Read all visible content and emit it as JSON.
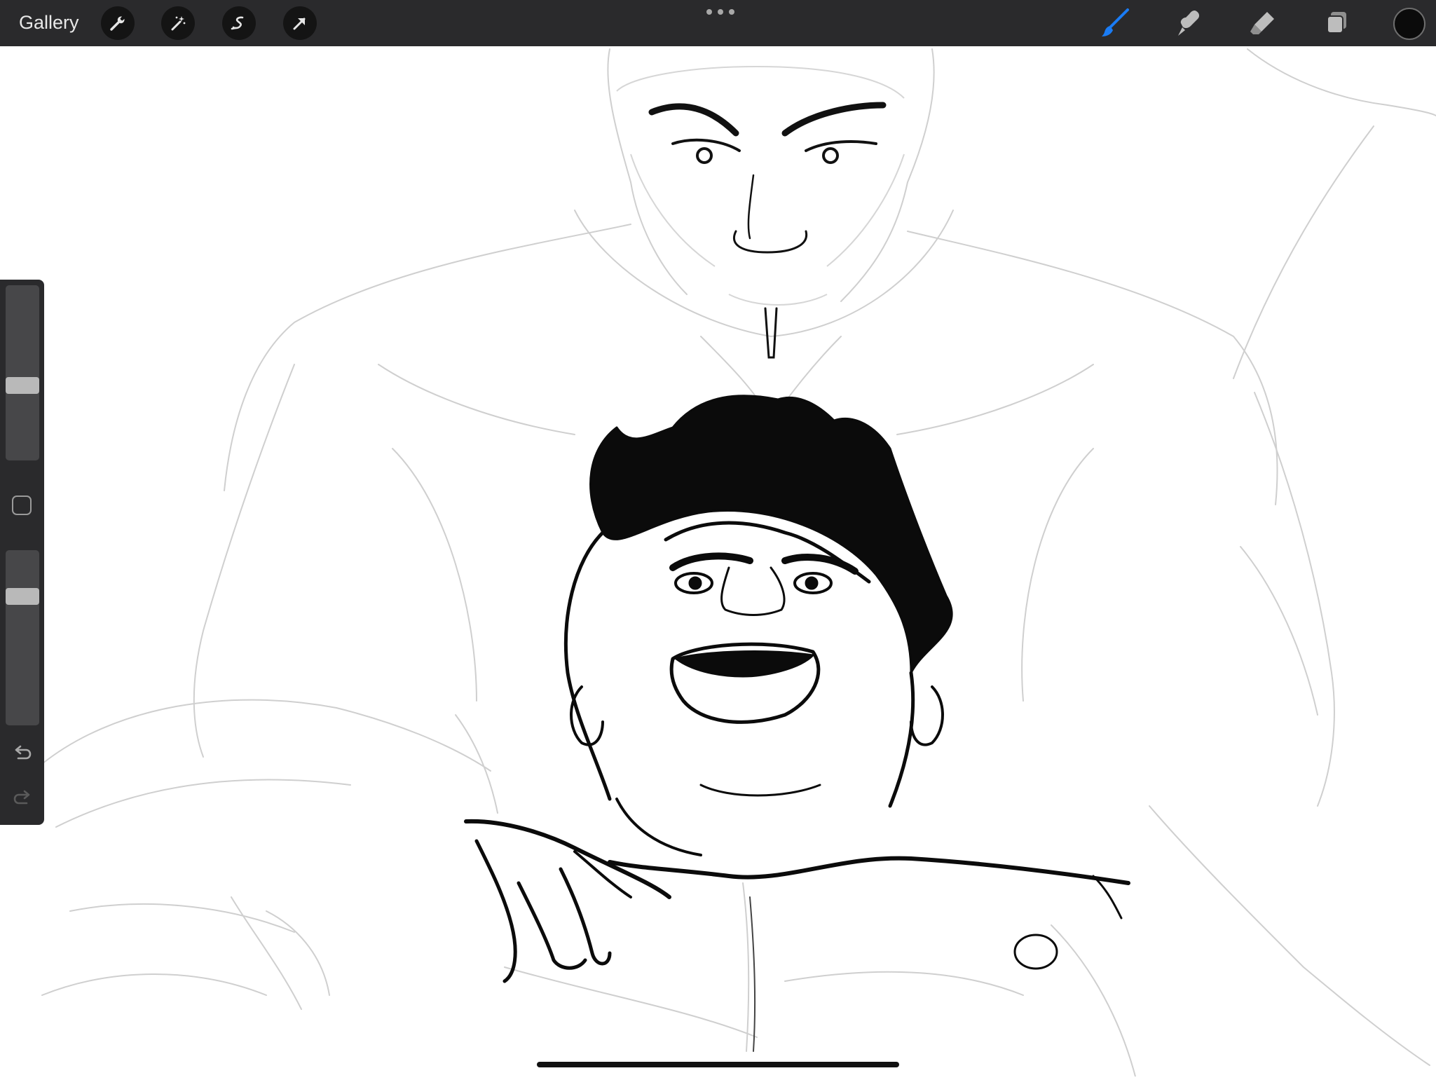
{
  "topbar": {
    "gallery_label": "Gallery",
    "left_tools": [
      {
        "icon": "wrench-icon",
        "name": "actions"
      },
      {
        "icon": "magic-wand-icon",
        "name": "adjustments"
      },
      {
        "icon": "selection-icon",
        "name": "selection"
      },
      {
        "icon": "transform-arrow-icon",
        "name": "transform"
      }
    ],
    "right_tools": [
      {
        "icon": "brush-icon",
        "name": "brush",
        "active": true
      },
      {
        "icon": "smudge-icon",
        "name": "smudge",
        "active": false
      },
      {
        "icon": "eraser-icon",
        "name": "eraser",
        "active": false
      },
      {
        "icon": "layers-icon",
        "name": "layers",
        "active": false
      }
    ],
    "active_color": "#0b0b0b",
    "accent_color": "#1a7cf5"
  },
  "sidebar": {
    "brush_size_level": 0.42,
    "opacity_level": 0.76,
    "icons": [
      "modify-square-icon",
      "undo-icon",
      "redo-icon"
    ]
  }
}
